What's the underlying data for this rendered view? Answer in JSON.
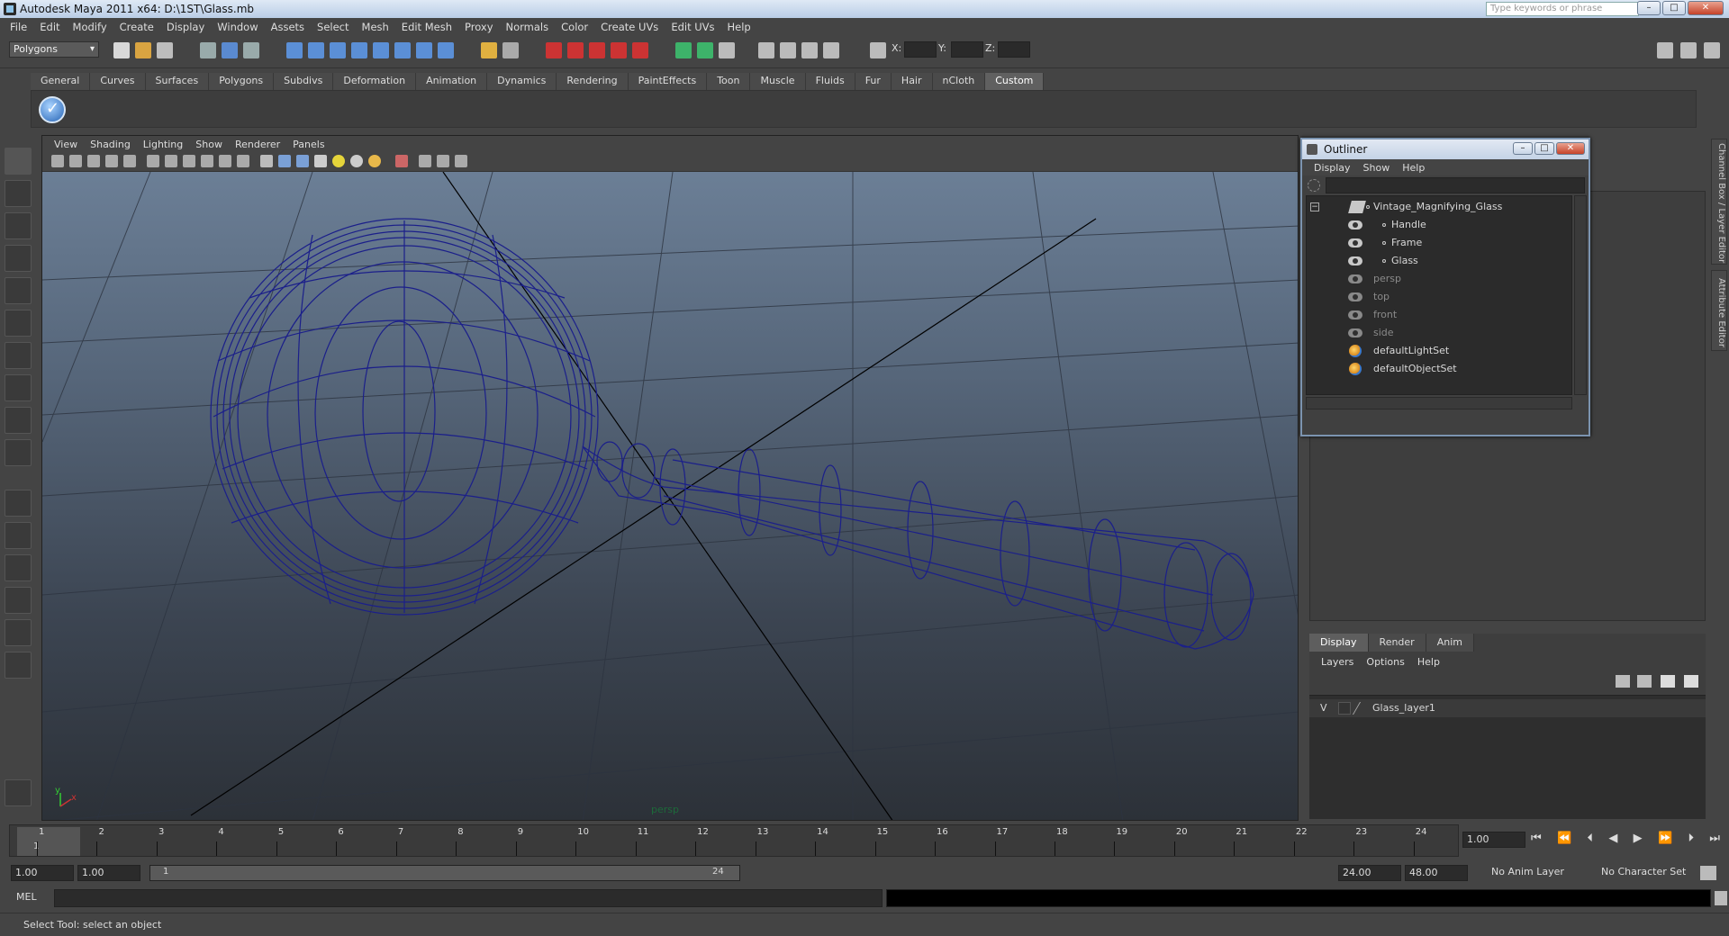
{
  "window": {
    "title": "Autodesk Maya 2011 x64: D:\\1ST\\Glass.mb",
    "help_placeholder": "Type keywords or phrase"
  },
  "menubar": [
    "File",
    "Edit",
    "Modify",
    "Create",
    "Display",
    "Window",
    "Assets",
    "Select",
    "Mesh",
    "Edit Mesh",
    "Proxy",
    "Normals",
    "Color",
    "Create UVs",
    "Edit UVs",
    "Help"
  ],
  "status": {
    "mode": "Polygons",
    "x_label": "X:",
    "y_label": "Y:",
    "z_label": "Z:"
  },
  "shelf_tabs": [
    "General",
    "Curves",
    "Surfaces",
    "Polygons",
    "Subdivs",
    "Deformation",
    "Animation",
    "Dynamics",
    "Rendering",
    "PaintEffects",
    "Toon",
    "Muscle",
    "Fluids",
    "Fur",
    "Hair",
    "nCloth",
    "Custom"
  ],
  "shelf_active": "Custom",
  "viewport": {
    "menu": [
      "View",
      "Shading",
      "Lighting",
      "Show",
      "Renderer",
      "Panels"
    ],
    "camera_label": "persp"
  },
  "outliner": {
    "title": "Outliner",
    "menu": [
      "Display",
      "Show",
      "Help"
    ],
    "items": [
      {
        "label": "Vintage_Magnifying_Glass",
        "type": "group",
        "dim": false
      },
      {
        "label": "Handle",
        "type": "mesh-child",
        "dim": false
      },
      {
        "label": "Frame",
        "type": "mesh-child",
        "dim": false
      },
      {
        "label": "Glass",
        "type": "mesh-child",
        "dim": false
      },
      {
        "label": "persp",
        "type": "camera",
        "dim": true
      },
      {
        "label": "top",
        "type": "camera",
        "dim": true
      },
      {
        "label": "front",
        "type": "camera",
        "dim": true
      },
      {
        "label": "side",
        "type": "camera",
        "dim": true
      },
      {
        "label": "defaultLightSet",
        "type": "set",
        "dim": false
      },
      {
        "label": "defaultObjectSet",
        "type": "set",
        "dim": false
      }
    ]
  },
  "right_tabs": [
    "Channel Box / Layer Editor",
    "Attribute Editor"
  ],
  "layer_panel": {
    "tabs": [
      "Display",
      "Render",
      "Anim"
    ],
    "active_tab": "Display",
    "menu": [
      "Layers",
      "Options",
      "Help"
    ],
    "layer": {
      "visibility": "V",
      "name": "Glass_layer1"
    }
  },
  "timeline": {
    "ticks": [
      "1",
      "2",
      "3",
      "4",
      "5",
      "6",
      "7",
      "8",
      "9",
      "10",
      "11",
      "12",
      "13",
      "14",
      "15",
      "16",
      "17",
      "18",
      "19",
      "20",
      "21",
      "22",
      "23",
      "24"
    ],
    "current_marker": "1",
    "current_frame": "1.00"
  },
  "range": {
    "start": "1.00",
    "playback_start": "1.00",
    "slider_start": "1",
    "slider_end": "24",
    "playback_end": "24.00",
    "end": "48.00",
    "anim_layer": "No Anim Layer",
    "character_set": "No Character Set"
  },
  "cmdline": {
    "label": "MEL"
  },
  "helpline": {
    "text": "Select Tool: select an object"
  },
  "colors": {
    "wireframe": "#1b1f8a",
    "viewport_top": "#6f839b",
    "viewport_bottom": "#2c3138",
    "ui_bg": "#444444"
  }
}
